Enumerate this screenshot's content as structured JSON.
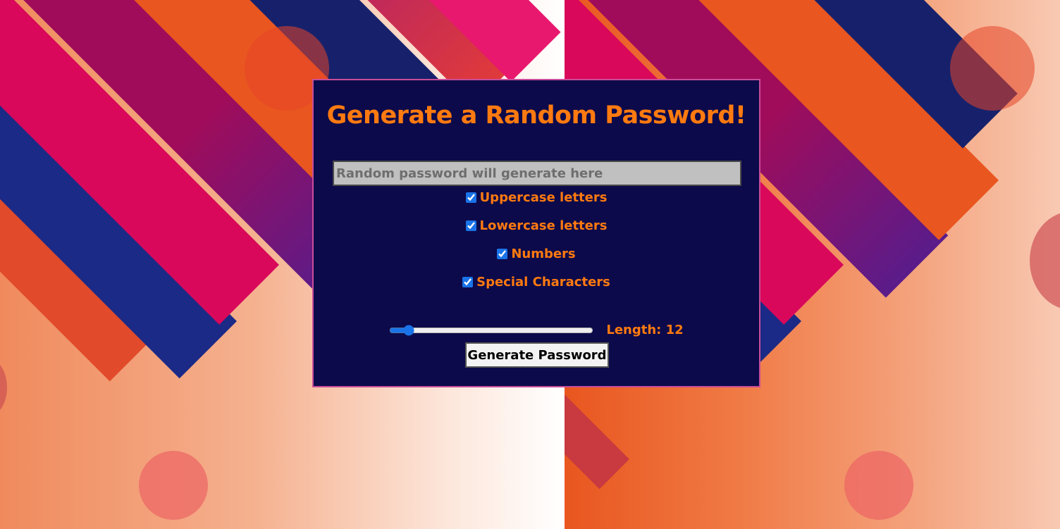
{
  "app": {
    "title": "Generate a Random Password!"
  },
  "password_field": {
    "placeholder": "Random password will generate here",
    "value": ""
  },
  "options": [
    {
      "label": "Uppercase letters",
      "checked": true
    },
    {
      "label": "Lowercase letters",
      "checked": true
    },
    {
      "label": "Numbers",
      "checked": true
    },
    {
      "label": "Special Characters",
      "checked": true
    }
  ],
  "length": {
    "label": "Length: 12",
    "value": 12
  },
  "generate_button": {
    "label": "Generate Password"
  },
  "colors": {
    "card_bg": "#0c0a4a",
    "accent": "#ff7a10",
    "card_border": "#c84d9a"
  }
}
